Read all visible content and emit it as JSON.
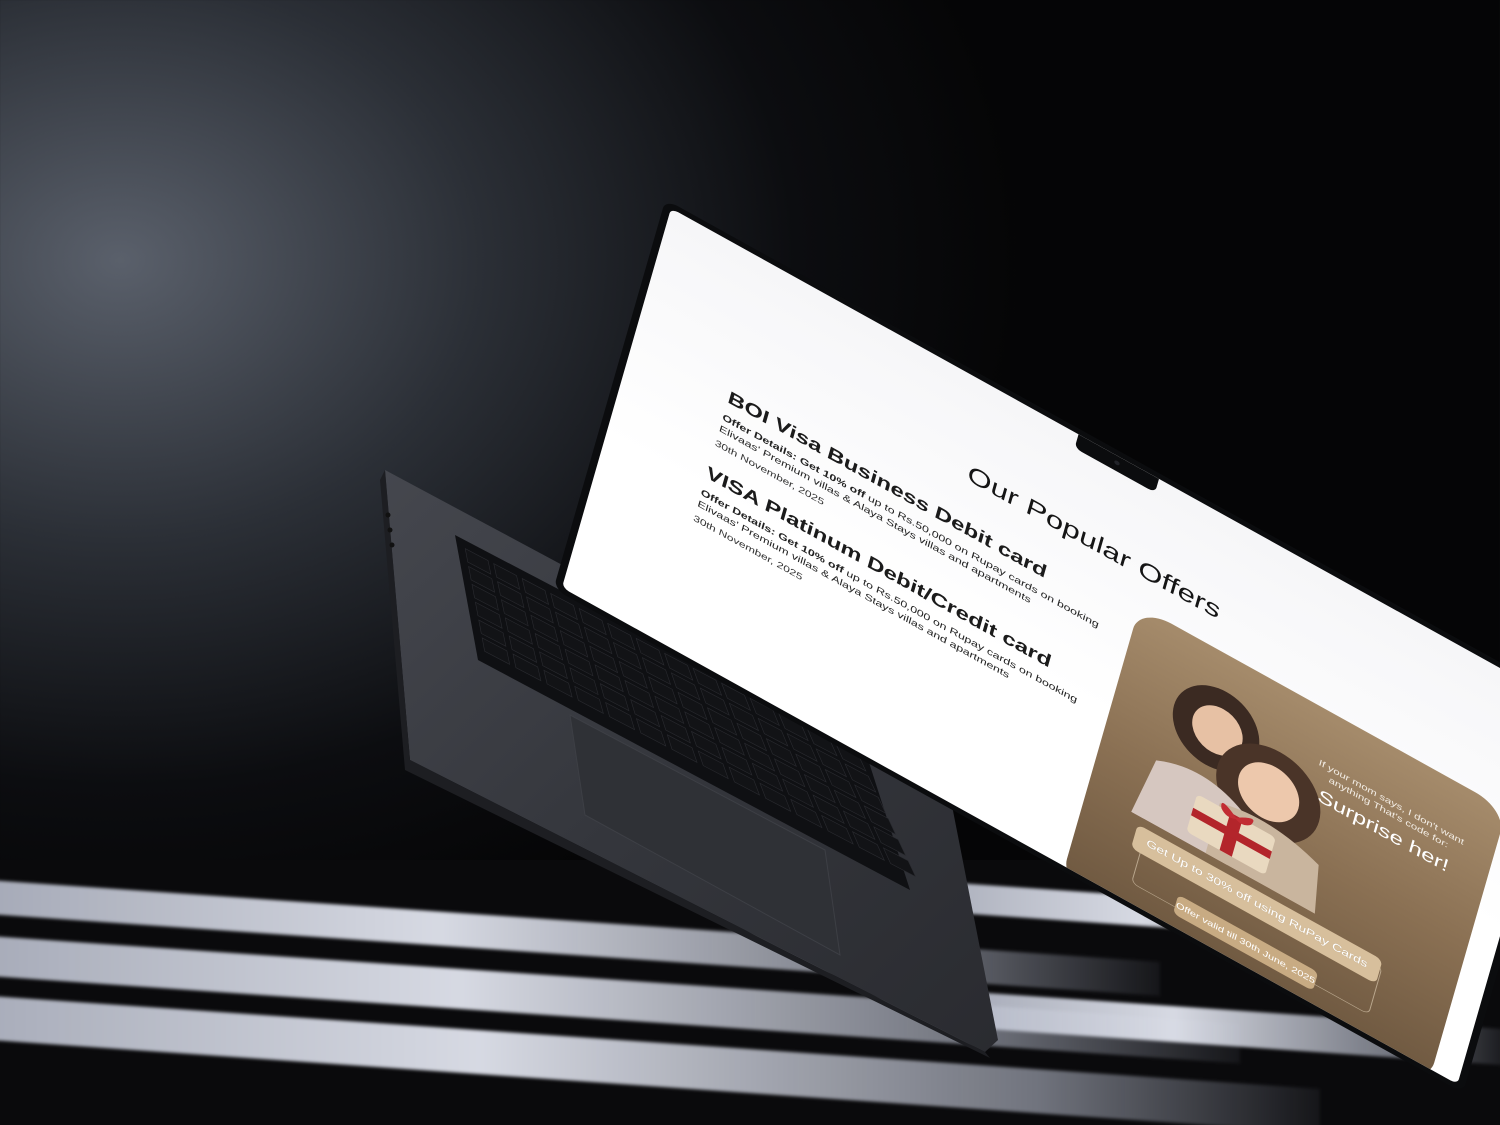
{
  "page": {
    "title": "Our Popular Offers"
  },
  "offers": [
    {
      "title": "BOI Visa Business Debit card",
      "details_label": "Offer Details:",
      "details_bold": "Get 10% off",
      "details_text": "up to Rs.50,000 on Rupay cards on booking Elivaas' Premium villas & Alaya Stays villas and apartments",
      "date": "30th November, 2025"
    },
    {
      "title": "VISA Platinum Debit/Credit card",
      "details_label": "Offer Details:",
      "details_bold": "Get 10% off",
      "details_text": "up to Rs.50,000 on Rupay cards on booking Elivaas' Premium villas & Alaya Stays villas and apartments",
      "date": "30th November, 2025"
    }
  ],
  "banner": {
    "small_copy": "If your mom says, I don't want anything That's code for:",
    "headline": "Surprise her!",
    "cta_label": "Get Up to 30% off using RuPay Cards",
    "validity": "Offer valid till 30th June, 2025",
    "colors": {
      "card_top": "#a58b6b",
      "card_bottom": "#6e5840",
      "cta": "#d7bf9c",
      "validity": "#c8ab83"
    }
  },
  "icons": {
    "camera": "camera-icon",
    "photo": "mother-daughter-gift-photo"
  }
}
